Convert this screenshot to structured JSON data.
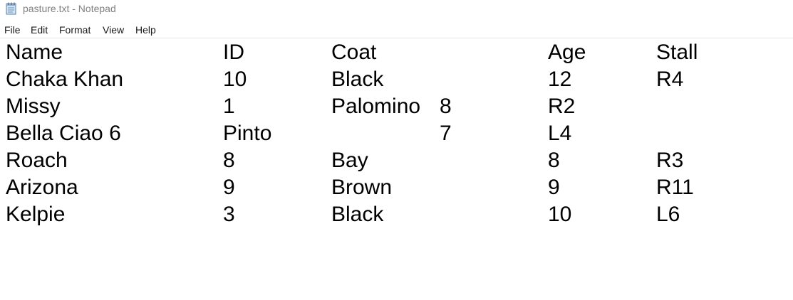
{
  "window": {
    "title": "pasture.txt - Notepad",
    "icon": "notepad-icon"
  },
  "menu": {
    "items": [
      "File",
      "Edit",
      "Format",
      "View",
      "Help"
    ]
  },
  "document": {
    "lines": [
      [
        "Name",
        "ID",
        "Coat",
        "",
        "Age",
        "Stall"
      ],
      [
        "Chaka Khan",
        "10",
        "Black",
        "",
        "12",
        "R4"
      ],
      [
        "Missy",
        "1",
        "Palomino",
        "8",
        "R2",
        ""
      ],
      [
        "Bella Ciao 6",
        "Pinto",
        "",
        "7",
        "L4",
        ""
      ],
      [
        "Roach",
        "8",
        "Bay",
        "",
        "8",
        "R3"
      ],
      [
        "Arizona",
        "9",
        "Brown",
        "",
        "9",
        "R11"
      ],
      [
        "Kelpie",
        "3",
        "Black",
        "",
        "10",
        "L6"
      ]
    ]
  },
  "colors": {
    "title_text": "#808080",
    "editor_text": "#000000",
    "background": "#ffffff"
  }
}
